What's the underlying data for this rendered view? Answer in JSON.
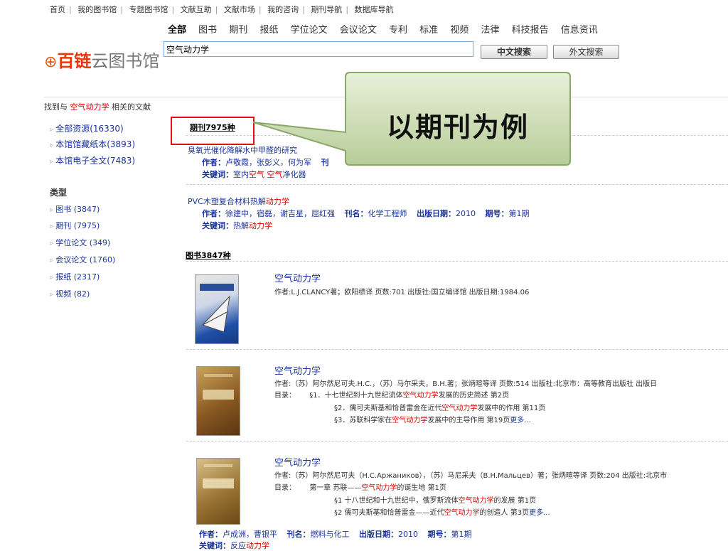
{
  "topnav": [
    "首页",
    "我的图书馆",
    "专题图书馆",
    "文献互助",
    "文献市场",
    "我的咨询",
    "期刊导航",
    "数据库导航"
  ],
  "categories": [
    "全部",
    "图书",
    "期刊",
    "报纸",
    "学位论文",
    "会议论文",
    "专利",
    "标准",
    "视频",
    "法律",
    "科技报告",
    "信息资讯"
  ],
  "logo": {
    "red": "百链",
    "gray": "云图书馆"
  },
  "search": {
    "value": "空气动力学",
    "btn_cn": "中文搜索",
    "btn_en": "外文搜索"
  },
  "found": {
    "prefix": "找到与",
    "keyword": "空气动力学",
    "suffix": "相关的文献"
  },
  "sidebar": {
    "resources": [
      "全部资源(16330)",
      "本馆馆藏纸本(3893)",
      "本馆电子全文(7483)"
    ],
    "type_heading": "类型",
    "types": [
      "图书 (3847)",
      "期刊 (7975)",
      "学位论文 (349)",
      "会议论文 (1760)",
      "报纸 (2317)",
      "视频 (82)"
    ]
  },
  "periodicals": {
    "heading": "期刊7975种",
    "items": [
      {
        "title": "臭氧光催化降解水中甲醛的研究",
        "author_label": "作者：",
        "authors": "卢敬霞，张彭义，何为军",
        "journal_label": "刊",
        "kw_label": "关键词：",
        "kw_pre": "室内",
        "kw_red1": "空气",
        "kw_mid": " ",
        "kw_red2": "空气",
        "kw_post": "净化器"
      },
      {
        "title_pre": "PVC木塑复合材料热解",
        "title_red": "动力学",
        "author_label": "作者：",
        "authors": "徐建中，宿磊，谢吉星，屈红强",
        "journal_label": "刊名：",
        "journal": "化学工程师",
        "date_label": "出版日期：",
        "date": "2010",
        "issue_label": "期号：",
        "issue": "第1期",
        "kw_label": "关键词：",
        "kw_pre": "热解",
        "kw_red": "动力学"
      }
    ]
  },
  "books": {
    "heading": "图书3847种",
    "items": [
      {
        "title": "空气动力学",
        "line1": "作者:L.J.CLANCY著；欧阳绩译 页数:701 出版社:国立编译馆 出版日期:1984.06"
      },
      {
        "title": "空气动力学",
        "line1": "作者:（苏）阿尔然尼可夫.H.C.，（苏）马尔采夫，B.H.著；张炳暄等译 页数:514 出版社:北京市：高等教育出版社 出版日",
        "toc_label": "目录：",
        "toc": [
          {
            "pre": "§1．十七世纪到十九世纪流体",
            "red": "空气动力学",
            "post": "发展的历史简述 第2页"
          },
          {
            "pre": "§2．儒可夫斯基和恰普雷金在近代",
            "red": "空气动力学",
            "post": "发展中的作用 第11页"
          },
          {
            "pre": "§3．苏联科学家在",
            "red": "空气动力学",
            "post": "发展中的主导作用 第19页",
            "more": "更多..."
          }
        ]
      },
      {
        "title": "空气动力学",
        "line1": "作者:（苏）阿尔然尼可夫（H.C.Аржаников），（苏）马尼采夫（B.H.Мальцев）著；张炳暄等译 页数:204 出版社:北京市",
        "toc_label": "目录：",
        "toc": [
          {
            "pre": "第一章 苏联——",
            "red": "空气动力学",
            "post": "的诞生地 第1页"
          },
          {
            "pre": "§1 十八世纪和十九世纪中，俄罗斯流体",
            "red": "空气动力学",
            "post": "的发展 第1页"
          },
          {
            "pre": "§2 儒可夫斯基和恰普雷金——近代",
            "red": "空气动力学",
            "post": "的创造人 第3页",
            "more": "更多..."
          }
        ]
      }
    ]
  },
  "bottom": {
    "author_label": "作者：",
    "authors": "卢成洲，曹银平",
    "journal_label": "刊名：",
    "journal": "燃料与化工",
    "date_label": "出版日期：",
    "date": "2010",
    "issue_label": "期号：",
    "issue": "第1期",
    "kw_label": "关键词：",
    "kw_pre": "反应",
    "kw_red": "动力学"
  },
  "callout": {
    "text": "以期刊为例"
  },
  "colors": {
    "highlight": "#d00000",
    "link": "#1a3399",
    "callout_fill": "#c9dcb0",
    "box": "#e01010"
  }
}
